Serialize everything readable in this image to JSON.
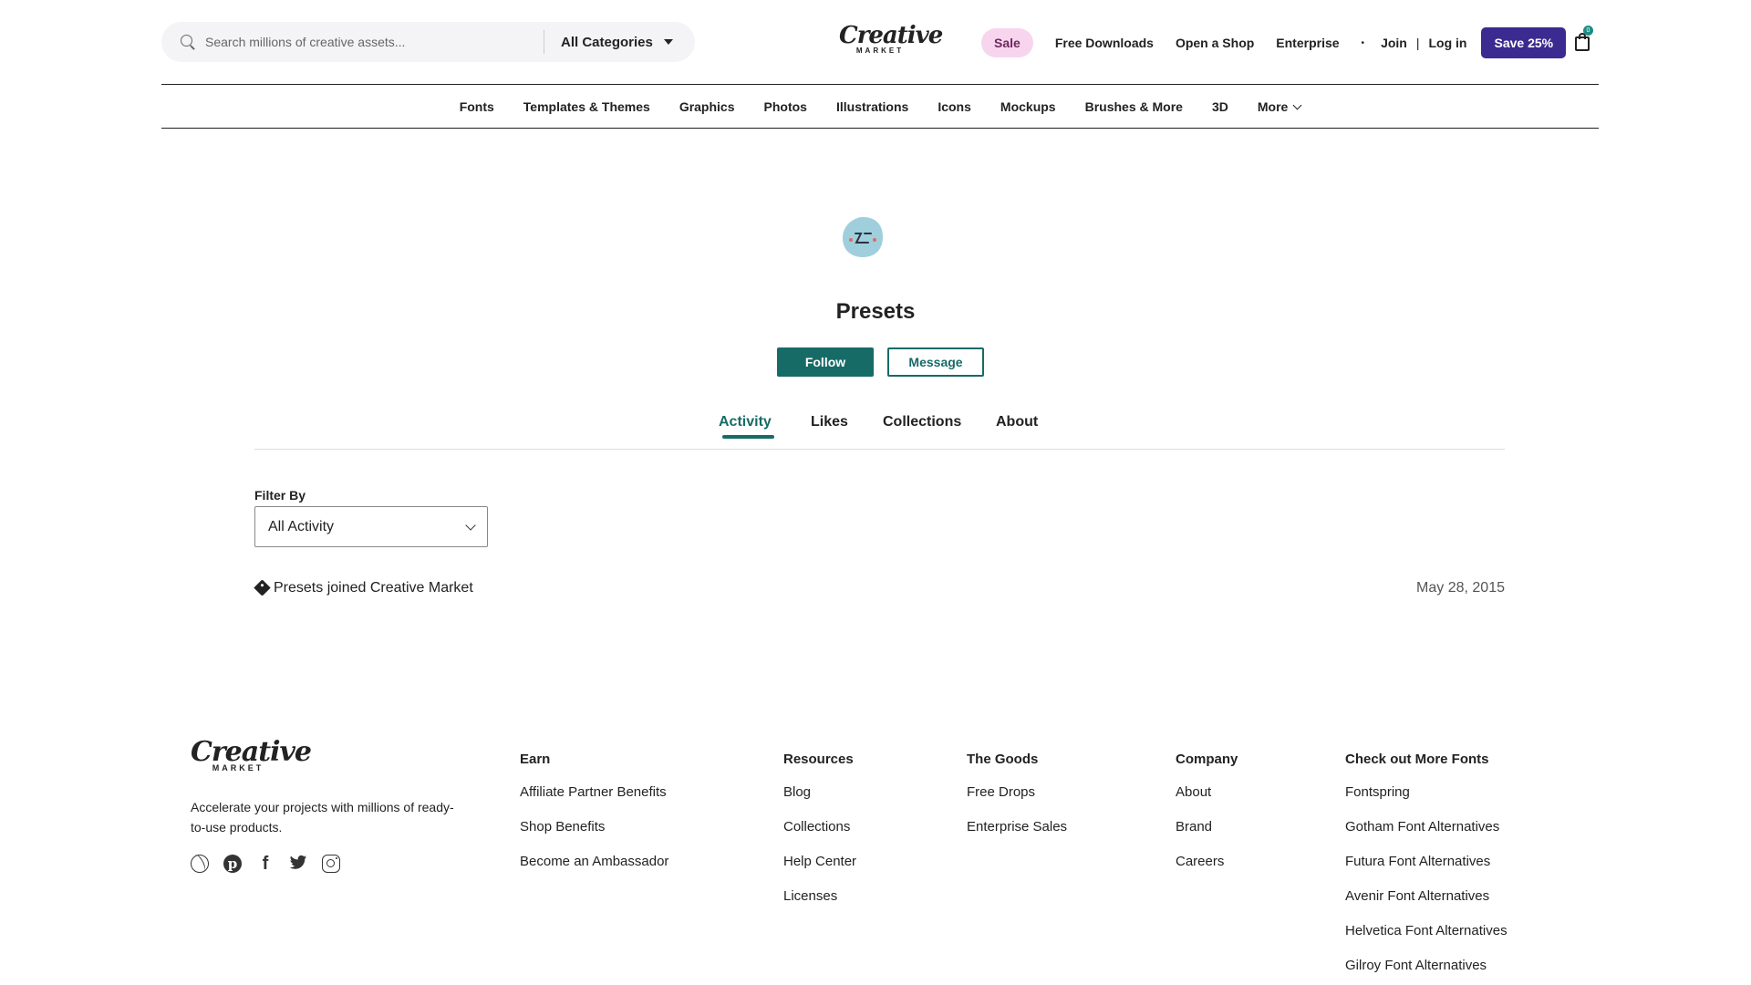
{
  "header": {
    "search_placeholder": "Search millions of creative assets...",
    "category_label": "All Categories",
    "logo_word": "Creative",
    "logo_sub": "MARKET",
    "sale_label": "Sale",
    "free_downloads": "Free Downloads",
    "open_shop": "Open a Shop",
    "enterprise": "Enterprise",
    "dot": "•",
    "join": "Join",
    "sep": "|",
    "login": "Log in",
    "save_label": "Save 25%",
    "cart_count": "0"
  },
  "categories": [
    "Fonts",
    "Templates & Themes",
    "Graphics",
    "Photos",
    "Illustrations",
    "Icons",
    "Mockups",
    "Brushes & More",
    "3D",
    "More"
  ],
  "profile": {
    "name": "Presets",
    "follow_label": "Follow",
    "message_label": "Message"
  },
  "tabs": [
    "Activity",
    "Likes",
    "Collections",
    "About"
  ],
  "filter": {
    "label": "Filter By",
    "value": "All Activity"
  },
  "activity": {
    "text": "Presets joined Creative Market",
    "date": "May 28, 2015"
  },
  "footer": {
    "logo_word": "Creative",
    "logo_sub": "MARKET",
    "tagline": "Accelerate your projects with millions of ready-to-use products.",
    "columns": [
      {
        "title": "Earn",
        "links": [
          "Affiliate Partner Benefits",
          "Shop Benefits",
          "Become an Ambassador"
        ]
      },
      {
        "title": "Resources",
        "links": [
          "Blog",
          "Collections",
          "Help Center",
          "Licenses"
        ]
      },
      {
        "title": "The Goods",
        "links": [
          "Free Drops",
          "Enterprise Sales"
        ]
      },
      {
        "title": "Company",
        "links": [
          "About",
          "Brand",
          "Careers"
        ]
      },
      {
        "title": "Check out More Fonts",
        "links": [
          "Fontspring",
          "Gotham Font Alternatives",
          "Futura Font Alternatives",
          "Avenir Font Alternatives",
          "Helvetica Font Alternatives",
          "Gilroy Font Alternatives"
        ]
      }
    ],
    "social_icons": [
      "dribbble-icon",
      "pinterest-icon",
      "facebook-icon",
      "twitter-icon",
      "instagram-icon"
    ],
    "pinterest_glyph": "p",
    "facebook_glyph": "f",
    "twitter_glyph": "🐦"
  },
  "colors": {
    "accent": "#176b66",
    "save_button": "#3b2a8f",
    "sale_pill": "#f8d5ee",
    "avatar": "#9fcfdc"
  }
}
